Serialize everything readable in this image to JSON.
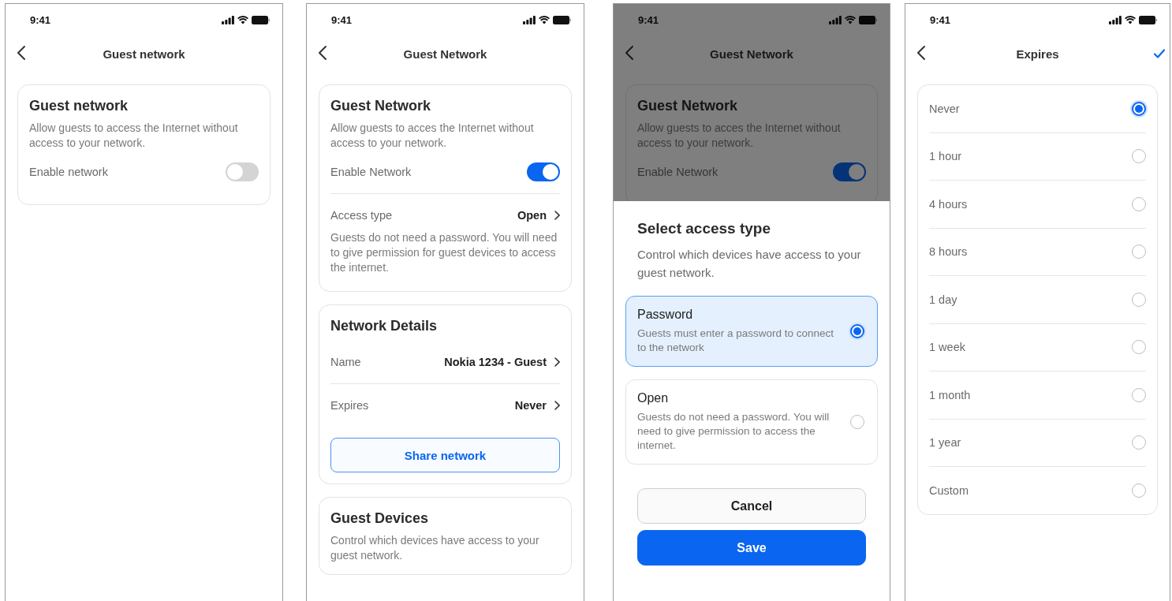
{
  "screens": [
    {
      "kind": "settings",
      "time": "9:41",
      "title": "Guest network",
      "cards": [
        {
          "title": "Guest network",
          "description": "Allow guests to access the Internet without access to your network.",
          "rows": [
            {
              "kind": "toggle",
              "label": "Enable network",
              "on": false
            }
          ]
        }
      ]
    },
    {
      "kind": "settings",
      "time": "9:41",
      "title": "Guest Network",
      "cards": [
        {
          "title": "Guest Network",
          "description": "Allow guests to acces the Internet without access to your network.",
          "rows": [
            {
              "kind": "toggle",
              "label": "Enable Network",
              "on": true
            },
            {
              "kind": "link",
              "label": "Access type",
              "value": "Open",
              "note": "Guests do not need a password. You will need to give permission for guest devices to access the internet."
            }
          ]
        },
        {
          "title": "Network Details",
          "rows": [
            {
              "kind": "link",
              "label": "Name",
              "value": "Nokia 1234 - Guest"
            },
            {
              "kind": "link",
              "label": "Expires",
              "value": "Never"
            },
            {
              "kind": "button",
              "label": "Share network"
            }
          ]
        },
        {
          "title": "Guest Devices",
          "description": "Control which devices have access to your guest network."
        }
      ]
    },
    {
      "kind": "sheet",
      "time": "9:41",
      "title": "Guest Network",
      "cards": [
        {
          "title": "Guest Network",
          "description": "Allow guests to acces the Internet without access to your network.",
          "rows": [
            {
              "kind": "toggle",
              "label": "Enable Network",
              "on": true
            }
          ]
        }
      ],
      "sheet": {
        "title": "Select access type",
        "description": "Control which devices have access to your guest network.",
        "options": [
          {
            "title": "Password",
            "description": "Guests must enter a password to connect to the network",
            "selected": true
          },
          {
            "title": "Open",
            "description": "Guests do not need a password. You will need to give permission to access the internet.",
            "selected": false
          }
        ],
        "buttons": [
          {
            "kind": "secondary",
            "label": "Cancel"
          },
          {
            "kind": "primary",
            "label": "Save"
          }
        ]
      }
    },
    {
      "kind": "picker",
      "time": "9:41",
      "title": "Expires",
      "options": [
        {
          "label": "Never",
          "selected": true
        },
        {
          "label": "1 hour",
          "selected": false
        },
        {
          "label": "4 hours",
          "selected": false
        },
        {
          "label": "8 hours",
          "selected": false
        },
        {
          "label": "1 day",
          "selected": false
        },
        {
          "label": "1 week",
          "selected": false
        },
        {
          "label": "1 month",
          "selected": false
        },
        {
          "label": "1 year",
          "selected": false
        },
        {
          "label": "Custom",
          "selected": false
        }
      ]
    }
  ]
}
